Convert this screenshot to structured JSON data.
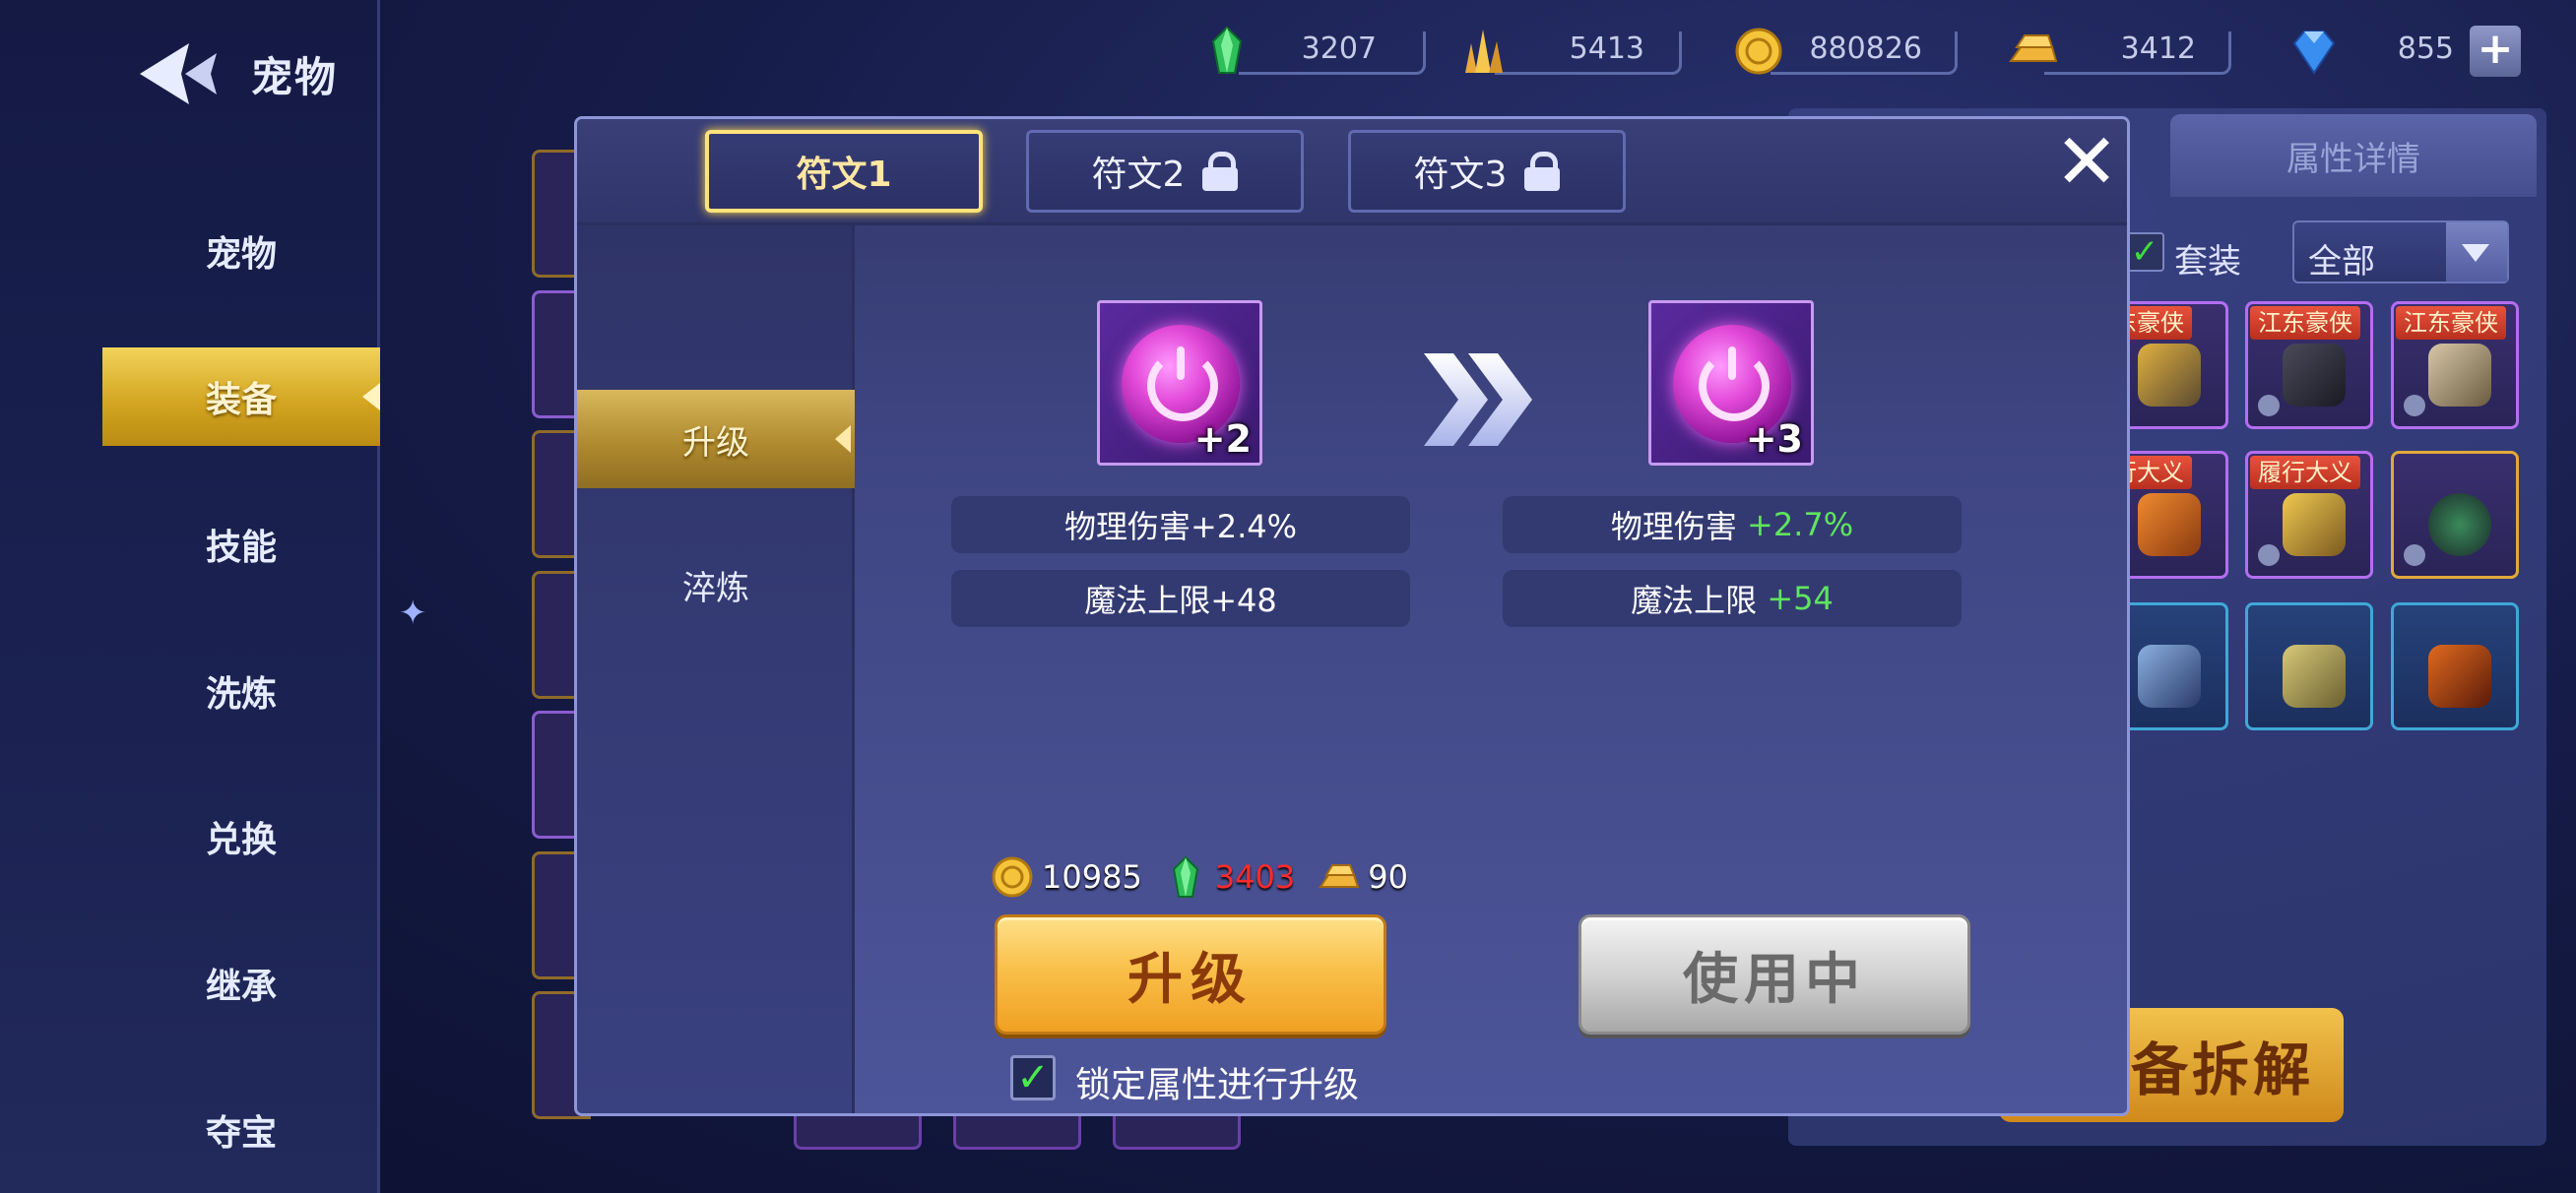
{
  "header": {
    "title": "宠物"
  },
  "sidebar": {
    "items": [
      {
        "label": "宠物"
      },
      {
        "label": "装备"
      },
      {
        "label": "技能"
      },
      {
        "label": "洗炼"
      },
      {
        "label": "兑换"
      },
      {
        "label": "继承"
      },
      {
        "label": "夺宝"
      }
    ],
    "active_index": 1
  },
  "currencies": [
    {
      "icon": "green-gem-icon",
      "value": "3207"
    },
    {
      "icon": "gold-crystal-icon",
      "value": "5413"
    },
    {
      "icon": "gold-coin-icon",
      "value": "880826"
    },
    {
      "icon": "gold-bar-icon",
      "value": "3412"
    },
    {
      "icon": "blue-diamond-icon",
      "value": "855"
    }
  ],
  "background_panel": {
    "tab_label": "属性详情",
    "suit_filter_label": "套装",
    "suit_filter_checked": true,
    "filter_select_value": "全部",
    "item_tags": [
      "东豪侠",
      "江东豪侠",
      "江东豪侠",
      "行大义",
      "履行大义"
    ],
    "dismantle_button": "备拆解"
  },
  "modal": {
    "tabs": [
      {
        "label": "符文1",
        "locked": false
      },
      {
        "label": "符文2",
        "locked": true
      },
      {
        "label": "符文3",
        "locked": true
      }
    ],
    "side_menu": [
      {
        "label": "升级"
      },
      {
        "label": "淬炼"
      }
    ],
    "current": {
      "level": "+2",
      "stat1": "物理伤害+2.4%",
      "stat2": "魔法上限+48"
    },
    "next": {
      "level": "+3",
      "stat1_name": "物理伤害 ",
      "stat1_value": "+2.7%",
      "stat2_name": "魔法上限 ",
      "stat2_value": "+54"
    },
    "costs": [
      {
        "icon": "gold-coin-icon",
        "value": "10985",
        "insufficient": false
      },
      {
        "icon": "green-gem-icon",
        "value": "3403",
        "insufficient": true
      },
      {
        "icon": "gold-bar-icon",
        "value": "90",
        "insufficient": false
      }
    ],
    "upgrade_button": "升级",
    "in_use_button": "使用中",
    "lock_checkbox_label": "锁定属性进行升级",
    "lock_checked": true
  },
  "colors": {
    "accent_gold": "#f0c040",
    "increase_green": "#5fe55f",
    "insufficient_red": "#ff2a2a"
  }
}
